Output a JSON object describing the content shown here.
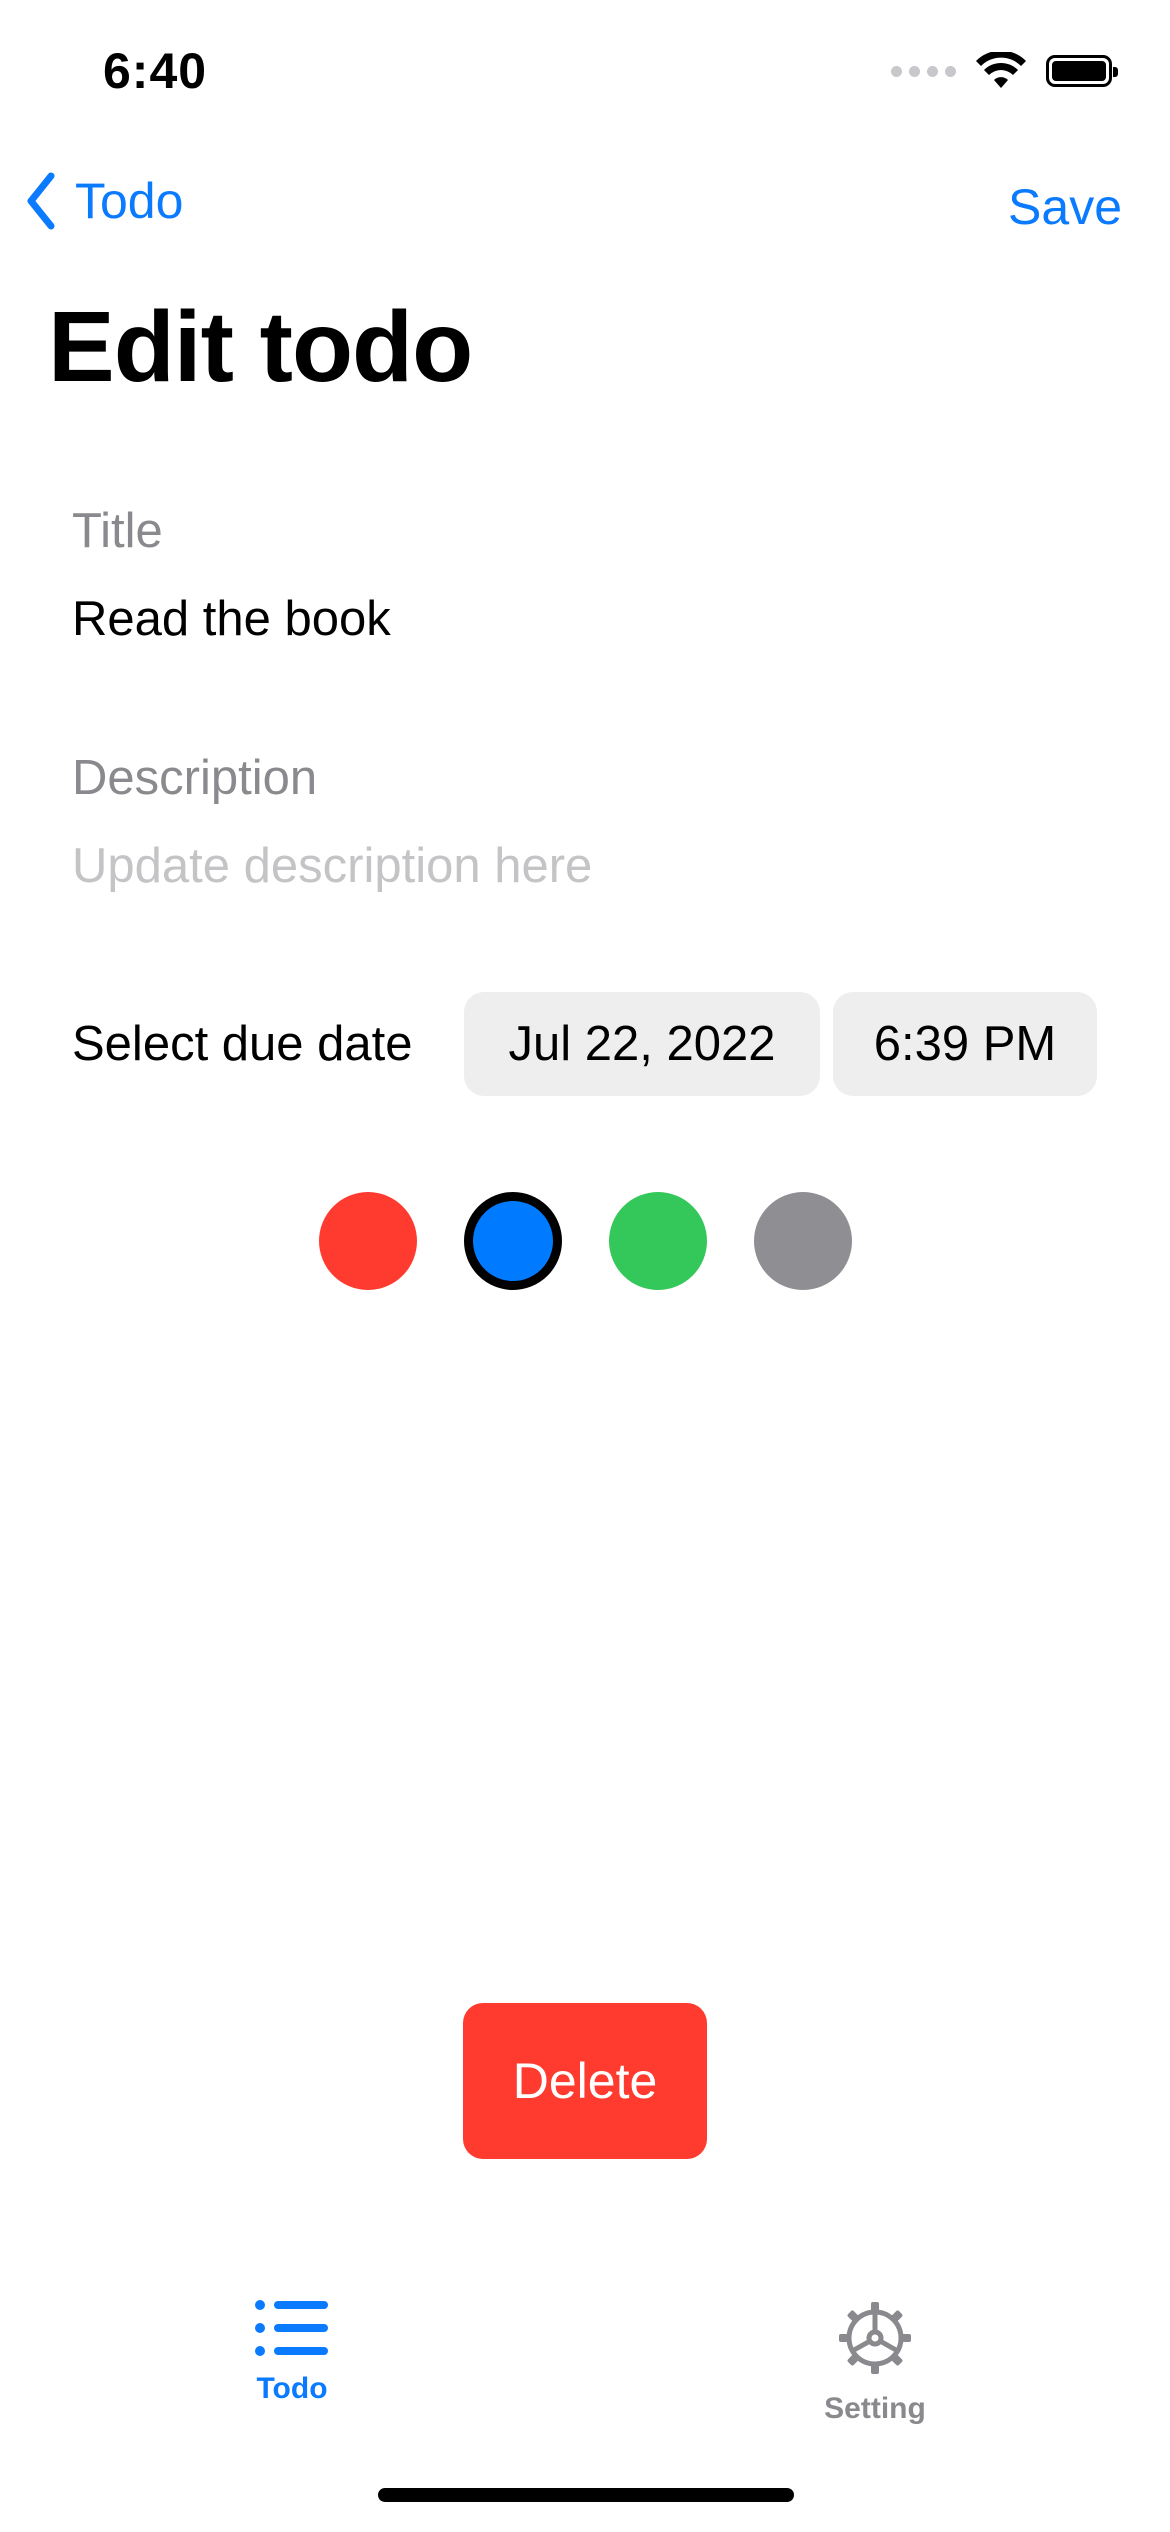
{
  "status_bar": {
    "time": "6:40",
    "icons": [
      "cellular-signal-icon",
      "wifi-icon",
      "battery-icon"
    ]
  },
  "nav": {
    "back_label": "Todo",
    "save_label": "Save",
    "title": "Edit todo"
  },
  "form": {
    "title_label": "Title",
    "title_value": "Read the book",
    "description_label": "Description",
    "description_placeholder": "Update description here",
    "due_label": "Select due date",
    "due_date": "Jul 22, 2022",
    "due_time": "6:39 PM"
  },
  "colors": {
    "options": [
      "#ff3b30",
      "#007aff",
      "#34c759",
      "#8e8e93"
    ],
    "selected": "#007aff"
  },
  "delete_label": "Delete",
  "tab_bar": {
    "tabs": [
      {
        "label": "Todo",
        "icon": "list-icon",
        "active": true
      },
      {
        "label": "Setting",
        "icon": "gear-icon",
        "active": false
      }
    ]
  },
  "accent_color": "#0a7aff",
  "destructive_color": "#ff3b30"
}
